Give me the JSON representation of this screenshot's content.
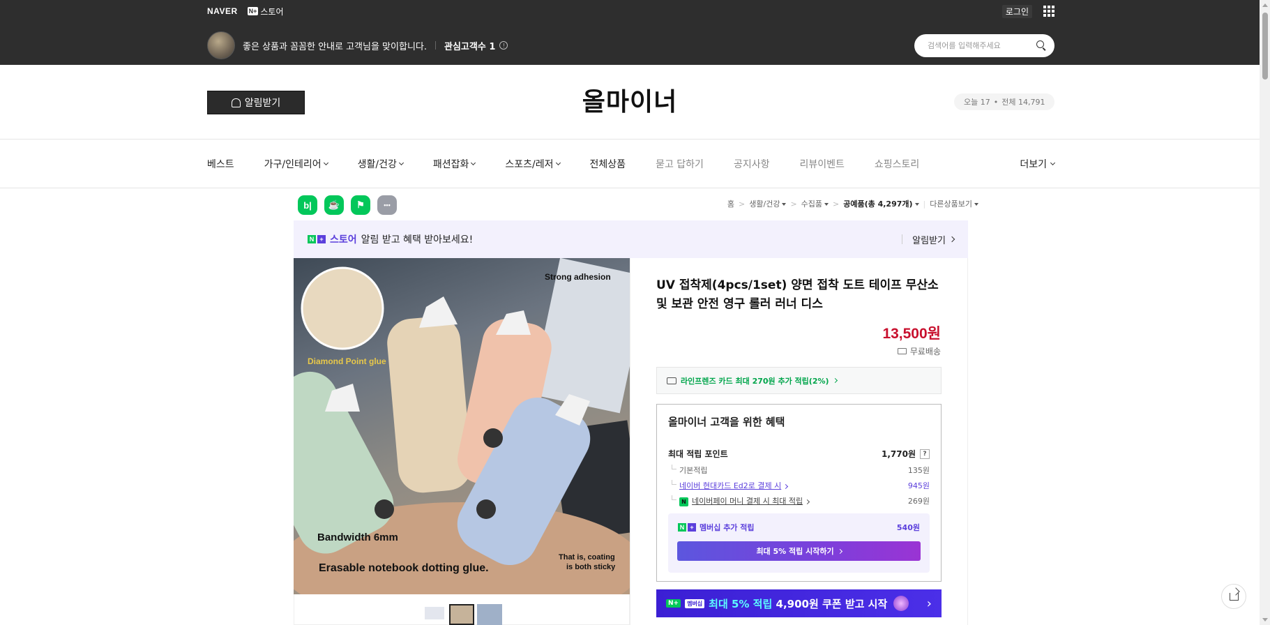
{
  "gnb": {
    "naver": "NAVER",
    "nplus": "N+",
    "store": "스토어",
    "login": "로그인"
  },
  "store_header": {
    "greeting": "좋은 상품과 꼼꼼한 안내로 고객님을 맞이합니다.",
    "fav_label": "관심고객수 1",
    "search_placeholder": "검색어를 입력해주세요"
  },
  "brand": {
    "alarm_button": "알림받기",
    "title": "올마이너",
    "today": "오늘 17",
    "dot": "•",
    "total": "전체 14,791"
  },
  "nav": {
    "items": [
      "베스트",
      "가구/인테리어",
      "생활/건강",
      "패션잡화",
      "스포츠/레저",
      "전체상품",
      "묻고 답하기",
      "공지사항",
      "리뷰이벤트",
      "쇼핑스토리"
    ],
    "more": "더보기"
  },
  "share_icons": [
    "blog-icon",
    "cafe-icon",
    "bookmark-icon",
    "more-icon"
  ],
  "share_glyphs": {
    "blog": "b|",
    "cafe": "☕",
    "bookmark": "⚑",
    "more": "•••"
  },
  "breadcrumb": {
    "home": "홈",
    "cat1": "생활/건강",
    "cat2": "수집품",
    "cat3": "공예품(총 4,297개)",
    "other": "다른상품보기",
    "arrow": ">"
  },
  "promo": {
    "brand": "스토어",
    "text": "알림 받고 혜택 받아보세요!",
    "button": "알림받기"
  },
  "photo": {
    "strong": "Strong adhesion",
    "diamond": "Diamond Point glue",
    "bandwidth": "Bandwidth 6mm",
    "erasable": "Erasable notebook dotting glue.",
    "coating1": "That is, coating",
    "coating2": "is both sticky"
  },
  "product": {
    "name": "UV 접착제(4pcs/1set) 양면 접착 도트 테이프 무산소 및 보관 안전 영구 롤러 러너 디스",
    "price": "13,500원",
    "shipping": "무료배송",
    "card_offer": "라인프렌즈 카드 최대 270원 추가 적립(2%)"
  },
  "benefit": {
    "title": "올마이너 고객을 위한 혜택",
    "max_label": "최대 적립 포인트",
    "max_value": "1,770원",
    "help": "?",
    "rows": [
      {
        "label": "기본적립",
        "value": "135원"
      },
      {
        "label": "네이버 현대카드 Ed2로 결제 시",
        "value": "945원"
      },
      {
        "label": "네이버페이 머니 결제 시 최대 적립",
        "value": "269원"
      }
    ],
    "npay_glyph": "N",
    "member_label": "멤버십 추가 적립",
    "member_value": "540원",
    "member_button": "최대 5% 적립 시작하기"
  },
  "banner": {
    "tag": "N+",
    "tag2": "멤버십",
    "text_hl": "최대 5% 적립",
    "text": "4,900원 쿠폰 받고 시작",
    "arrow": "›"
  },
  "colors": {
    "price": "#c8102e",
    "accent": "#5b3fdc",
    "naver_green": "#03c75a",
    "dark": "#2e2e2e"
  }
}
